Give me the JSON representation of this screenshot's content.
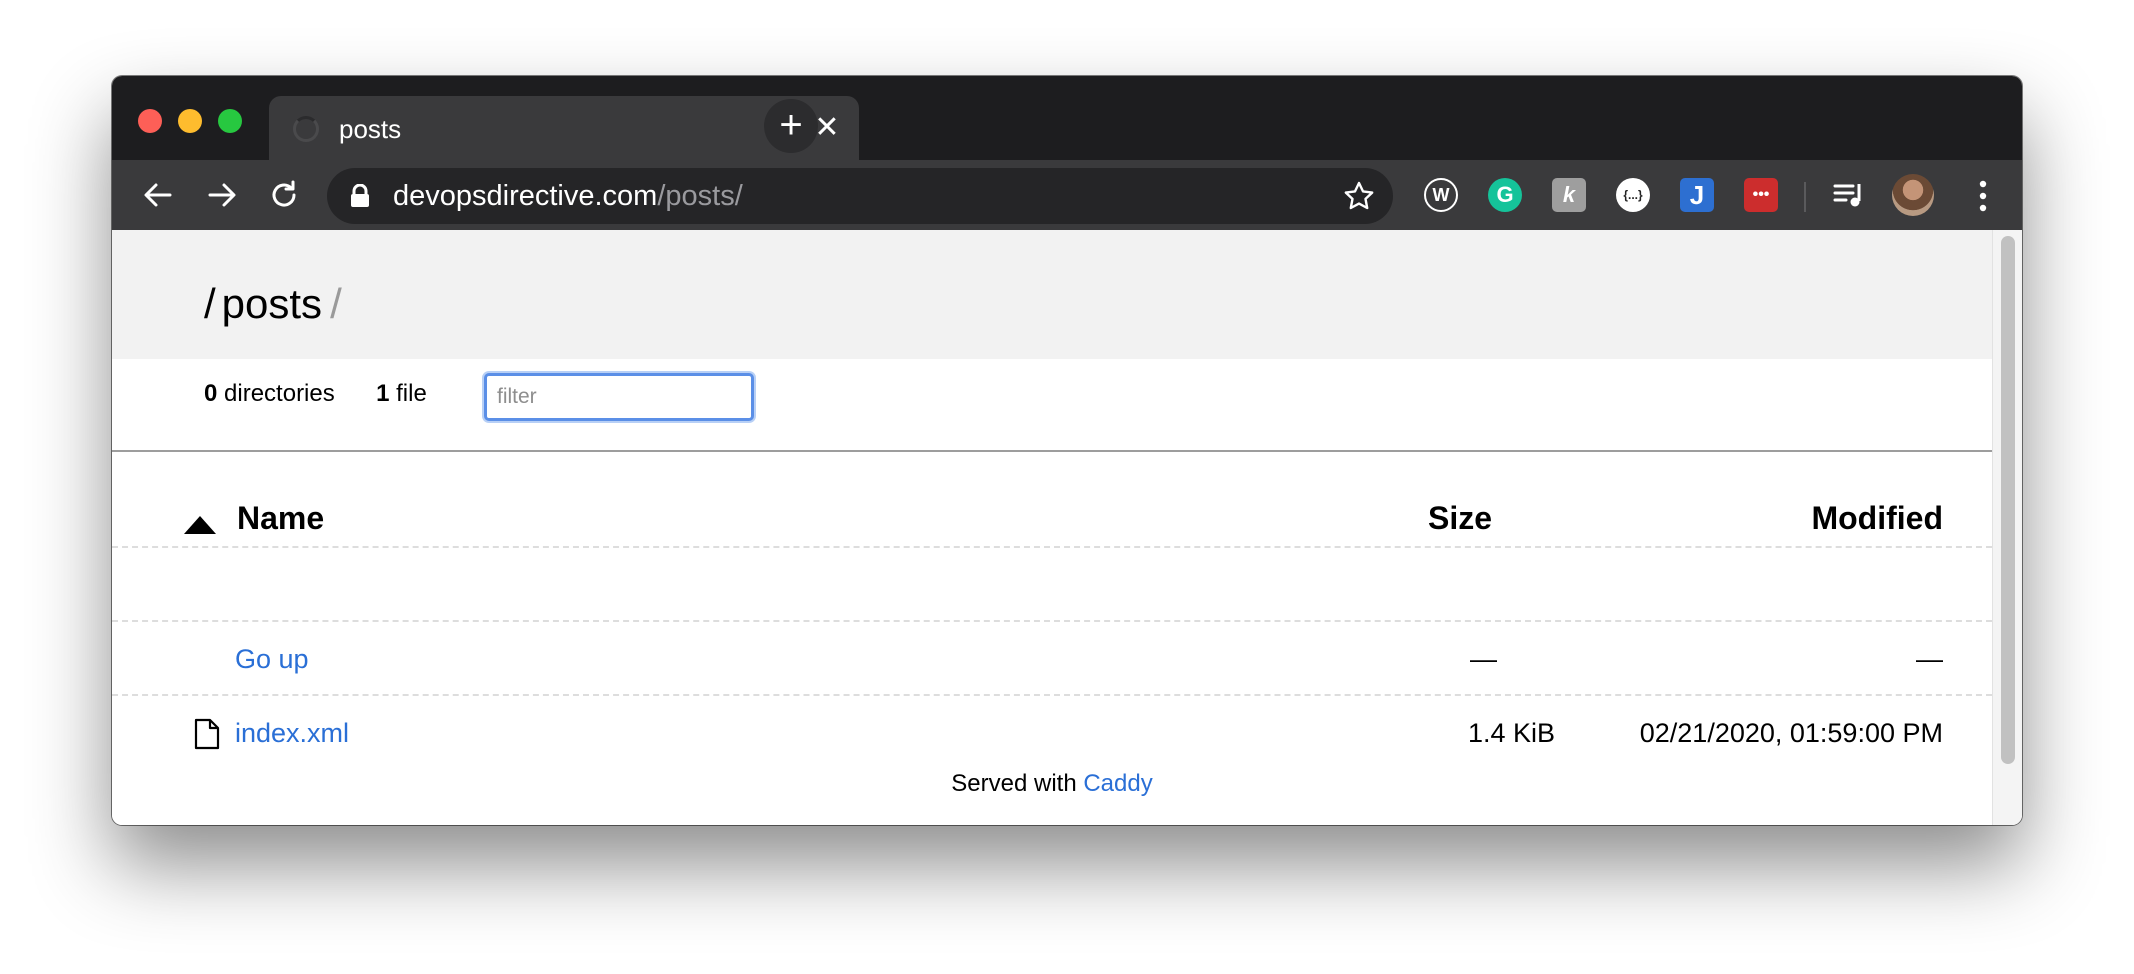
{
  "browser": {
    "tab": {
      "title": "posts",
      "close_symbol": "✕"
    },
    "new_tab_symbol": "+",
    "url": {
      "host": "devopsdirective.com",
      "path": "/posts/"
    },
    "extensions": [
      {
        "name": "wordpress-icon",
        "label": "W",
        "color": "#2b2b2d"
      },
      {
        "name": "grammarly-icon",
        "label": "G",
        "color": "#15c39a"
      },
      {
        "name": "kiwi-icon",
        "label": "k",
        "color": "#9e9e9e"
      },
      {
        "name": "json-icon",
        "label": "{...}",
        "color": "#ffffff"
      },
      {
        "name": "jira-icon",
        "label": "J",
        "color": "#2d6fd1"
      },
      {
        "name": "lastpass-icon",
        "label": "•••",
        "color": "#cc2d2d"
      }
    ]
  },
  "listing": {
    "breadcrumb": {
      "slash_leading": "/",
      "current": "posts",
      "slash_trailing": "/"
    },
    "summary": {
      "dir_count": "0",
      "dir_label": "directories",
      "file_count": "1",
      "file_label": "file"
    },
    "filter_placeholder": "filter",
    "columns": {
      "name": "Name",
      "size": "Size",
      "modified": "Modified"
    },
    "rows": [
      {
        "name": "Go up",
        "size": "—",
        "modified": "—"
      },
      {
        "name": "index.xml",
        "size": "1.4 KiB",
        "modified": "02/21/2020, 01:59:00 PM"
      }
    ],
    "footer": {
      "text": "Served with",
      "link": "Caddy"
    }
  },
  "colors": {
    "accent_link": "#2a6fd6",
    "focus_ring": "#5b8fe7"
  }
}
